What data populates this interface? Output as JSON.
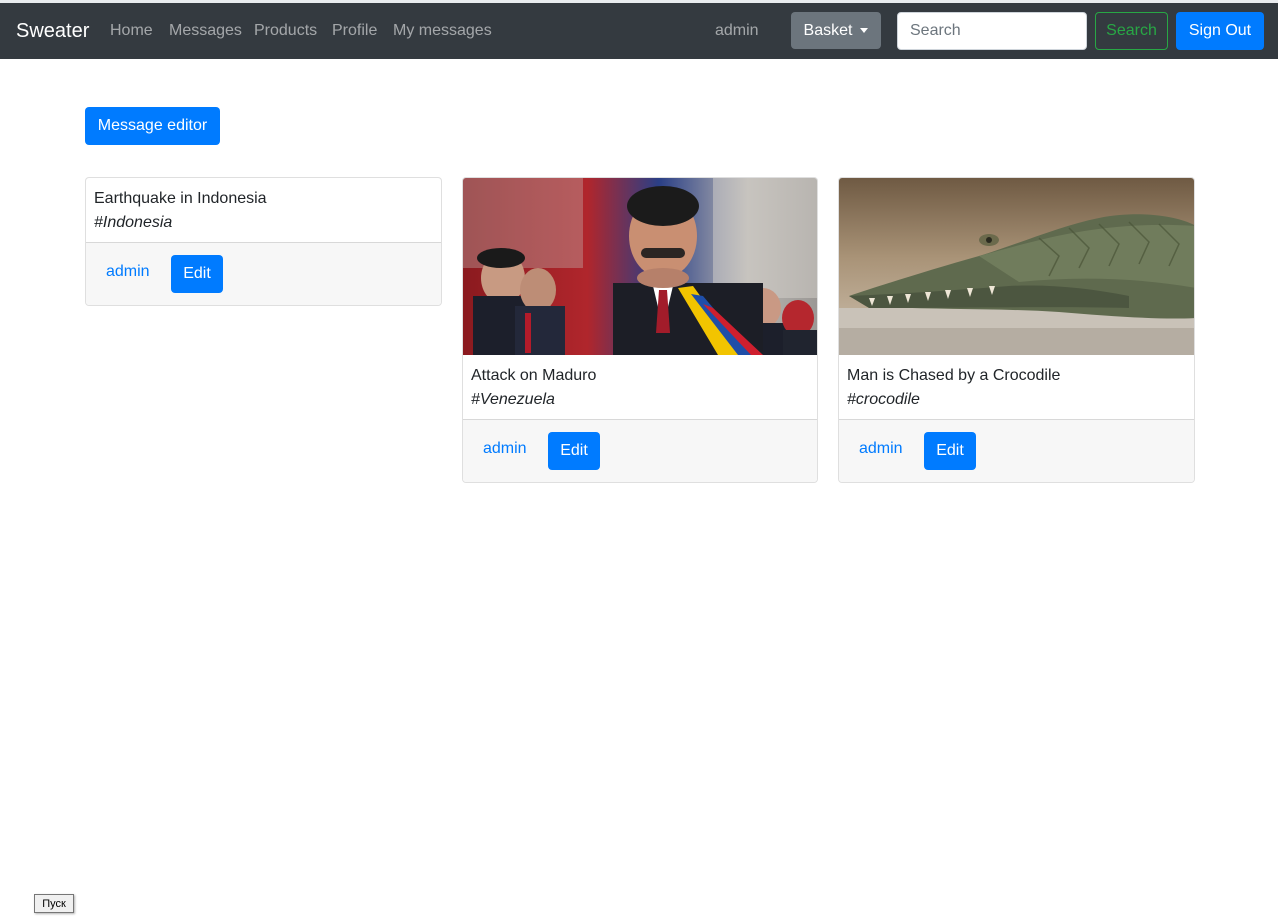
{
  "navbar": {
    "brand": "Sweater",
    "links": [
      "Home",
      "Messages",
      "Products",
      "Profile",
      "My messages"
    ],
    "user": "admin",
    "basket_label": "Basket",
    "search_placeholder": "Search",
    "search_button": "Search",
    "signout_button": "Sign Out"
  },
  "editor_button": "Message editor",
  "cards": [
    {
      "title": "Earthquake in Indonesia",
      "tag": "#Indonesia",
      "author": "admin",
      "edit_label": "Edit",
      "has_image": false
    },
    {
      "title": "Attack on Maduro",
      "tag": "#Venezuela",
      "author": "admin",
      "edit_label": "Edit",
      "has_image": true
    },
    {
      "title": "Man is Chased by a Crocodile",
      "tag": "#crocodile",
      "author": "admin",
      "edit_label": "Edit",
      "has_image": true
    }
  ],
  "taskbar_tooltip": "Пуск",
  "colors": {
    "navbar_bg": "#343a40",
    "primary": "#007bff",
    "success": "#28a745",
    "secondary": "#6c757d"
  }
}
